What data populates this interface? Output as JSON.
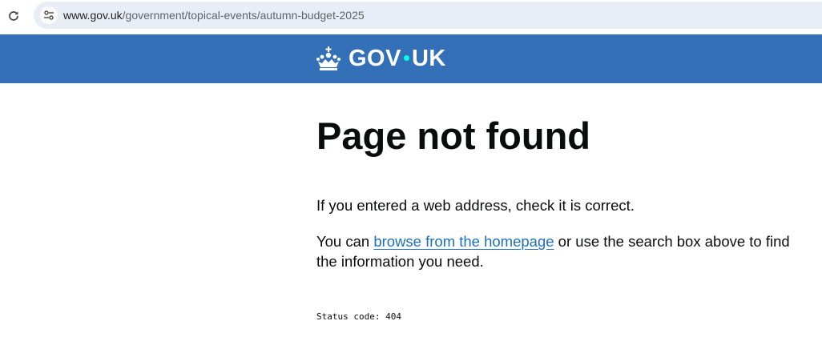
{
  "browser": {
    "url_host": "www.gov.uk",
    "url_path": "/government/topical-events/autumn-budget-2025"
  },
  "header": {
    "logo_text_left": "GOV",
    "logo_text_right": "UK",
    "background_color": "#3470b7",
    "dot_color": "#00ffe0"
  },
  "main": {
    "title": "Page not found",
    "paragraph1": "If you entered a web address, check it is correct.",
    "paragraph2_before": "You can ",
    "paragraph2_link": "browse from the homepage",
    "paragraph2_after": " or use the search box above to find the information you need.",
    "status_code": "Status code: 404"
  }
}
